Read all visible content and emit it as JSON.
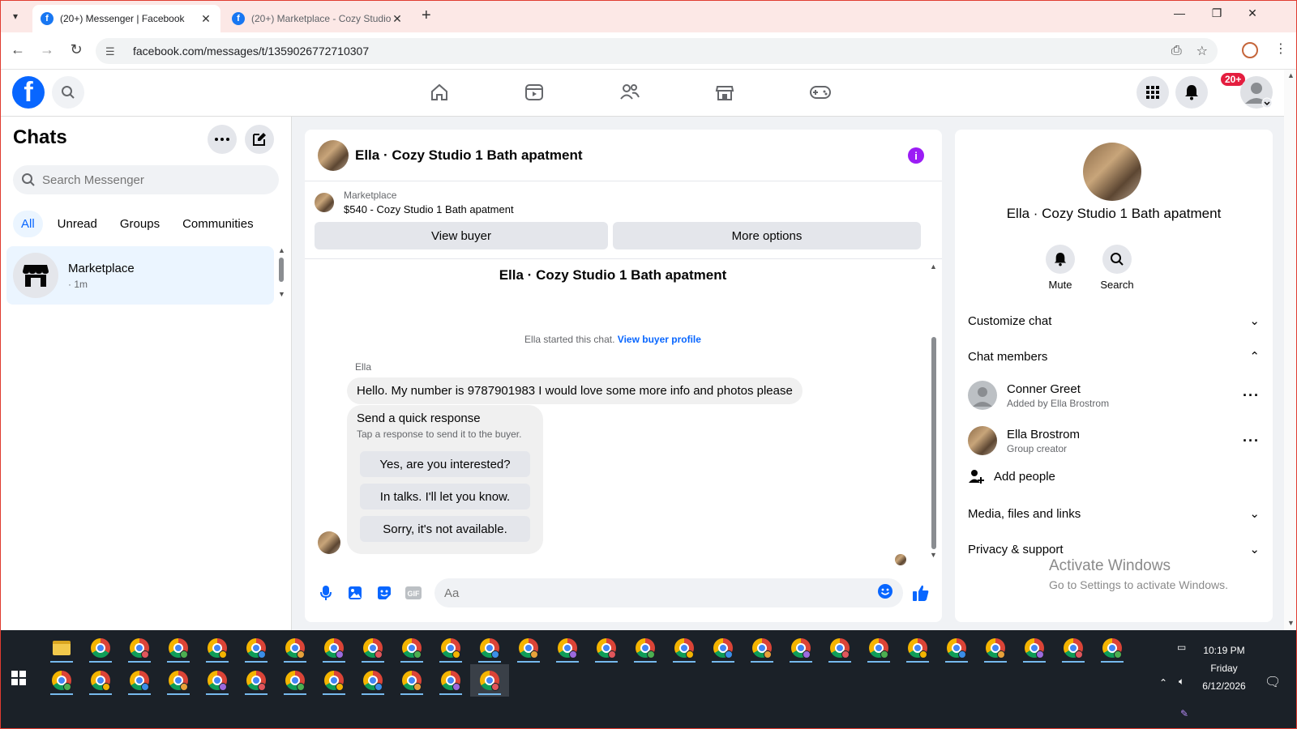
{
  "browser": {
    "tabs": [
      {
        "title": "(20+) Messenger | Facebook",
        "active": true
      },
      {
        "title": "(20+) Marketplace - Cozy Studio",
        "active": false
      }
    ],
    "url": "facebook.com/messages/t/1359026772710307"
  },
  "header": {
    "notification_badge": "20+",
    "nav_icons": [
      "home-icon",
      "video-icon",
      "friends-icon",
      "marketplace-icon",
      "gaming-icon"
    ]
  },
  "sidebar": {
    "title": "Chats",
    "search_placeholder": "Search Messenger",
    "filters": [
      "All",
      "Unread",
      "Groups",
      "Communities"
    ],
    "conversations": [
      {
        "name": "Marketplace",
        "time": "· 1m"
      }
    ]
  },
  "chat": {
    "title": "Ella · Cozy Studio 1 Bath apatment",
    "marketplace_label": "Marketplace",
    "listing": "$540 - Cozy Studio 1 Bath apatment",
    "view_buyer": "View buyer",
    "more_options": "More options",
    "thread_title": "Ella · Cozy Studio 1 Bath apatment",
    "started_text": "Ella started this chat.",
    "started_link": "View buyer profile",
    "sender": "Ella",
    "message": "Hello. My number is 9787901983 I would love some more info and photos please",
    "quick_response_title": "Send a quick response",
    "quick_response_sub": "Tap a response to send it to the buyer.",
    "quick_responses": [
      "Yes, are you interested?",
      "In talks. I'll let you know.",
      "Sorry, it's not available."
    ],
    "composer_placeholder": "Aa"
  },
  "details": {
    "name": "Ella · Cozy Studio 1 Bath apatment",
    "mute": "Mute",
    "search": "Search",
    "customize_chat": "Customize chat",
    "chat_members": "Chat members",
    "members": [
      {
        "name": "Conner Greet",
        "sub": "Added by Ella Brostrom"
      },
      {
        "name": "Ella Brostrom",
        "sub": "Group creator"
      }
    ],
    "add_people": "Add people",
    "media": "Media, files and links",
    "privacy": "Privacy & support"
  },
  "watermark": {
    "line1": "Activate Windows",
    "line2": "Go to Settings to activate Windows."
  },
  "taskbar": {
    "time": "10:19 PM",
    "day": "Friday",
    "date": "6/12/2026"
  },
  "colors": {
    "facebook_blue": "#0866ff",
    "messenger_purple": "#9b1cf5",
    "tab_strip": "#fce8e6",
    "taskbar": "#1b2128"
  }
}
